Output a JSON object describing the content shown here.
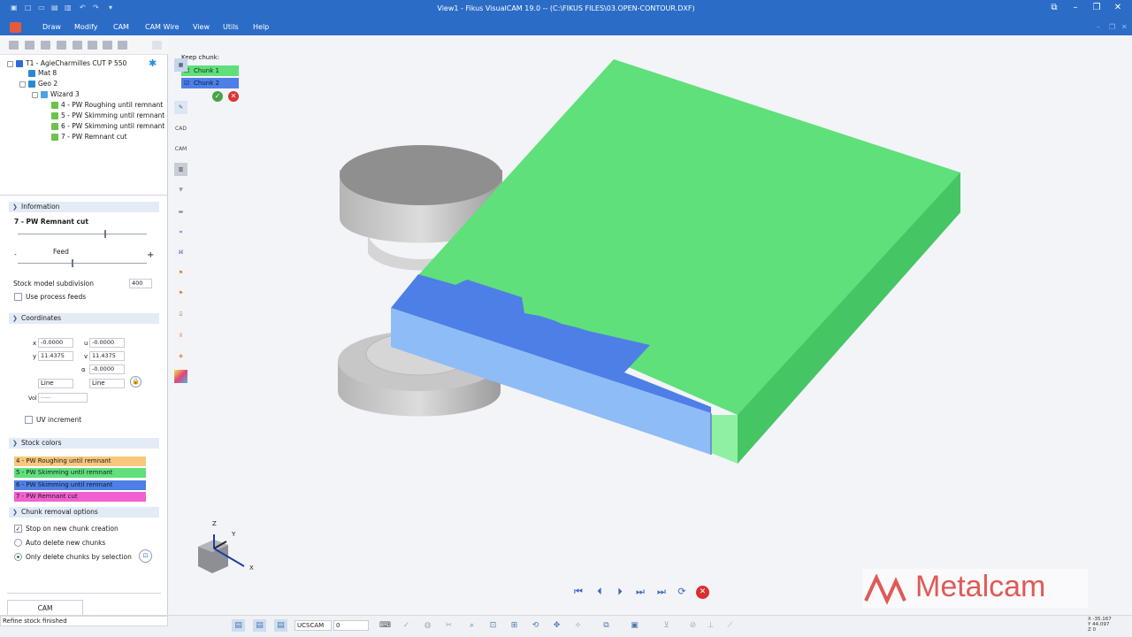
{
  "window": {
    "title": "View1 - Fikus VisualCAM 19.0 -- (C:\\FIKUS FILES\\03.OPEN-CONTOUR.DXF)"
  },
  "menu": [
    "Draw",
    "Modify",
    "CAM",
    "CAM Wire",
    "View",
    "Utils",
    "Help"
  ],
  "tree": {
    "root": "T1 - AgieCharmilles CUT P 550",
    "mat": "Mat 8",
    "geo": "Geo 2",
    "wizard": "Wizard 3",
    "ops": [
      {
        "label": "4 - PW Roughing until remnant"
      },
      {
        "label": "5 - PW Skimming until remnant"
      },
      {
        "label": "6 - PW Skimming until remnant"
      },
      {
        "label": "7 - PW Remnant cut"
      }
    ]
  },
  "information": {
    "header": "Information",
    "op_title": "7 - PW Remnant cut",
    "feed_label": "Feed",
    "minus": "-",
    "plus": "+",
    "subdivision_label": "Stock model subdivision",
    "subdivision_value": "400",
    "use_feeds_label": "Use process feeds"
  },
  "coordinates": {
    "header": "Coordinates",
    "x_label": "x",
    "x_value": "-0.0000",
    "y_label": "y",
    "y_value": "11.4375",
    "u_label": "u",
    "u_value": "-0.0000",
    "v_label": "v",
    "v_value": "11.4375",
    "alpha_label": "α",
    "alpha_value": "-0.0000",
    "line_left": "Line",
    "line_right": "Line",
    "vol_label": "Vol",
    "vol_value": "-----",
    "uv_label": "UV increment"
  },
  "stock_colors": {
    "header": "Stock colors",
    "items": [
      {
        "label": "4 - PW Roughing until remnant",
        "color": "#f8c77c"
      },
      {
        "label": "5 - PW Skimming until remnant",
        "color": "#5fe07a"
      },
      {
        "label": "6 - PW Skimming until remnant",
        "color": "#4d7fe6"
      },
      {
        "label": "7 - PW Remnant cut",
        "color": "#f25fd0"
      }
    ]
  },
  "chunk_options": {
    "header": "Chunk removal options",
    "stop_label": "Stop on new chunk creation",
    "auto_label": "Auto delete new chunks",
    "only_label": "Only delete chunks by selection"
  },
  "keep_chunk": {
    "title": "Keep chunk:",
    "chunk1": "Chunk 1",
    "chunk2": "Chunk 2"
  },
  "vertical_toolbar": {
    "cad": "CAD",
    "cam": "CAM"
  },
  "axes": {
    "z": "Z",
    "y": "Y",
    "x": "X"
  },
  "status": {
    "message": "Refine stock finished",
    "tab": "CAM",
    "ucs": "UCSCAM",
    "layer": "0",
    "coords": "X -35.167\nY 44.097\nZ 0"
  },
  "brand": "Metalcam",
  "colors": {
    "accent": "#2b6cc7",
    "chunk1": "#5fe07a",
    "chunk2": "#4d7fe6",
    "brand": "#e05a55"
  }
}
